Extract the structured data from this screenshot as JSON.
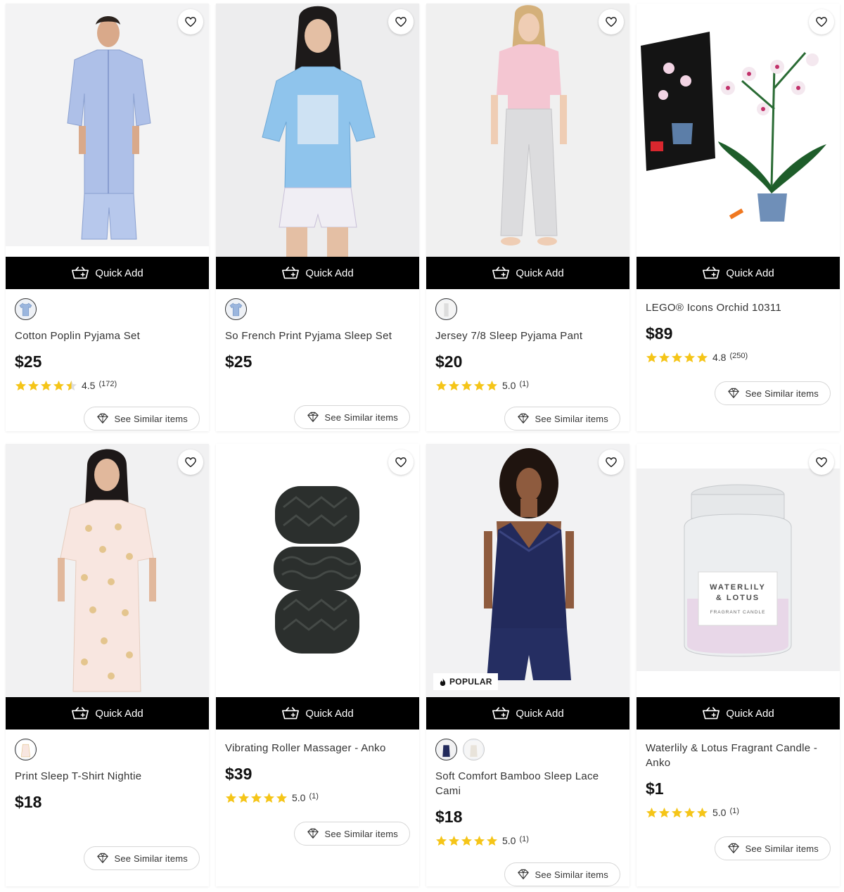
{
  "quick_add_label": "Quick Add",
  "see_similar_label": "See Similar items",
  "colors": {
    "black": "#000000",
    "star": "#f5c518",
    "page": "#ffffff",
    "image_bg": "#f4f4f5"
  },
  "products": [
    {
      "name": "Cotton Poplin Pyjama Set",
      "price": "$25",
      "rating": "4.5",
      "reviews": "(172)",
      "stars": 4.5,
      "swatches": 1
    },
    {
      "name": "So French Print Pyjama Sleep Set",
      "price": "$25",
      "swatches": 1
    },
    {
      "name": "Jersey 7/8 Sleep Pyjama Pant",
      "price": "$20",
      "rating": "5.0",
      "reviews": "(1)",
      "stars": 5,
      "swatches": 1
    },
    {
      "name": "LEGO® Icons Orchid 10311",
      "price": "$89",
      "rating": "4.8",
      "reviews": "(250)",
      "stars": 5,
      "swatches": 0
    },
    {
      "name": "Print Sleep T-Shirt Nightie",
      "price": "$18",
      "swatches": 1
    },
    {
      "name": "Vibrating Roller Massager - Anko",
      "price": "$39",
      "rating": "5.0",
      "reviews": "(1)",
      "stars": 5,
      "swatches": 0
    },
    {
      "name": "Soft Comfort Bamboo Sleep Lace Cami",
      "price": "$18",
      "rating": "5.0",
      "reviews": "(1)",
      "stars": 5,
      "swatches": 2,
      "badge": "POPULAR"
    },
    {
      "name": "Waterlily & Lotus Fragrant Candle - Anko",
      "price": "$1",
      "rating": "5.0",
      "reviews": "(1)",
      "stars": 5,
      "swatches": 0,
      "candle_label_1": "WATERLILY",
      "candle_label_2": "& LOTUS",
      "candle_label_3": "FRAGRANT CANDLE"
    }
  ]
}
